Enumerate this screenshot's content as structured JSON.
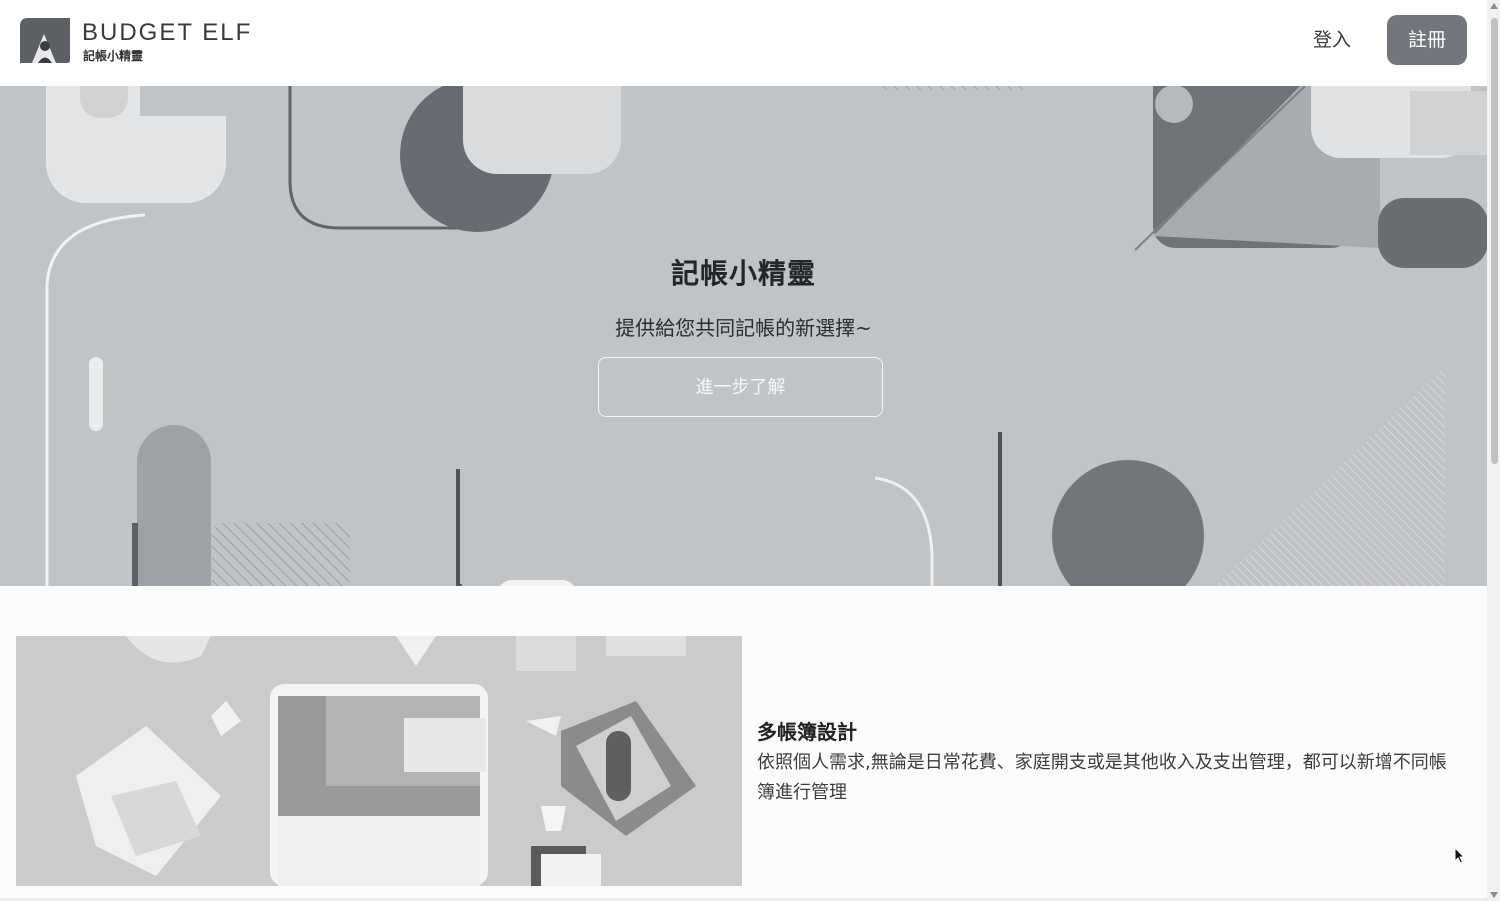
{
  "header": {
    "logo_en": "BUDGET ELF",
    "logo_zh": "記帳小精靈",
    "login_label": "登入",
    "register_label": "註冊"
  },
  "hero": {
    "title": "記帳小精靈",
    "subtitle": "提供給您共同記帳的新選擇~",
    "cta_label": "進一步了解"
  },
  "feature": {
    "title": "多帳簿設計",
    "description": "依照個人需求,無論是日常花費、家庭開支或是其他收入及支出管理，都可以新增不同帳簿進行管理"
  },
  "colors": {
    "register_button": "#72757b",
    "hero_background": "#c1c4c7",
    "page_background": "#fdfcfd"
  }
}
